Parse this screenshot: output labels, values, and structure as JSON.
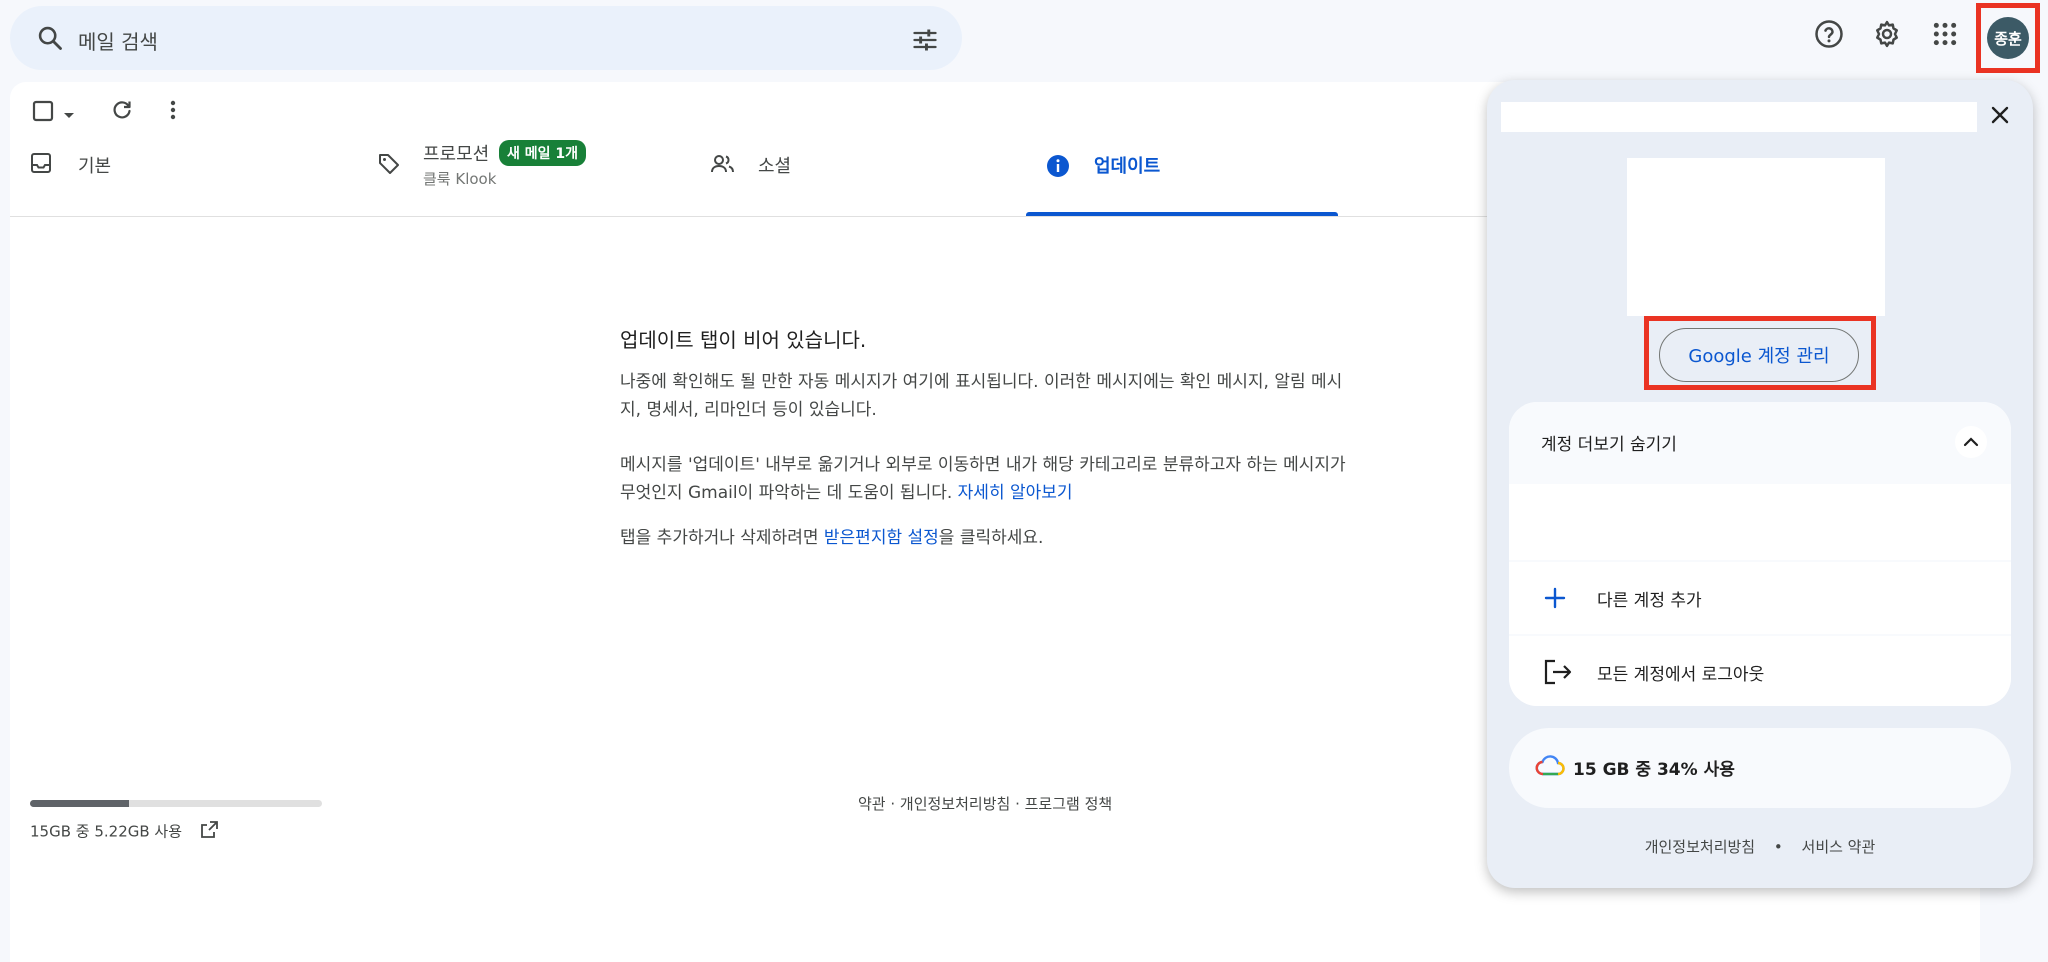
{
  "search": {
    "placeholder": "메일 검색"
  },
  "account": {
    "avatar_text": "종훈"
  },
  "tabs": [
    {
      "label": "기본"
    },
    {
      "label": "프로모션",
      "badge": "새 메일 1개",
      "sublabel": "클룩 Klook"
    },
    {
      "label": "소셜"
    },
    {
      "label": "업데이트"
    }
  ],
  "empty": {
    "title": "업데이트 탭이 비어 있습니다.",
    "p1": "나중에 확인해도 될 만한 자동 메시지가 여기에 표시됩니다. 이러한 메시지에는 확인 메시지, 알림 메시지, 명세서, 리마인더 등이 있습니다.",
    "p2_text": "메시지를 '업데이트' 내부로 옮기거나 외부로 이동하면 내가 해당 카테고리로 분류하고자 하는 메시지가 무엇인지 Gmail이 파악하는 데 도움이 됩니다. ",
    "p2_link": "자세히 알아보기",
    "p3_pre": "탭을 추가하거나 삭제하려면 ",
    "p3_link": "받은편지함 설정",
    "p3_post": "을 클릭하세요."
  },
  "storage": {
    "text": "15GB 중 5.22GB 사용",
    "used_fraction": 0.34
  },
  "footer": {
    "links": "약관 · 개인정보처리방침 · 프로그램 정책"
  },
  "popup": {
    "manage_label": "Google 계정 관리",
    "toggle_label": "계정 더보기 숨기기",
    "add_account": "다른 계정 추가",
    "logout_all": "모든 계정에서 로그아웃",
    "storage_text": "15 GB 중 34% 사용",
    "privacy": "개인정보처리방침",
    "separator": "•",
    "terms": "서비스 약관"
  },
  "colors": {
    "accent": "#0b57d0",
    "badge": "#188038",
    "highlight": "#ea3323"
  }
}
